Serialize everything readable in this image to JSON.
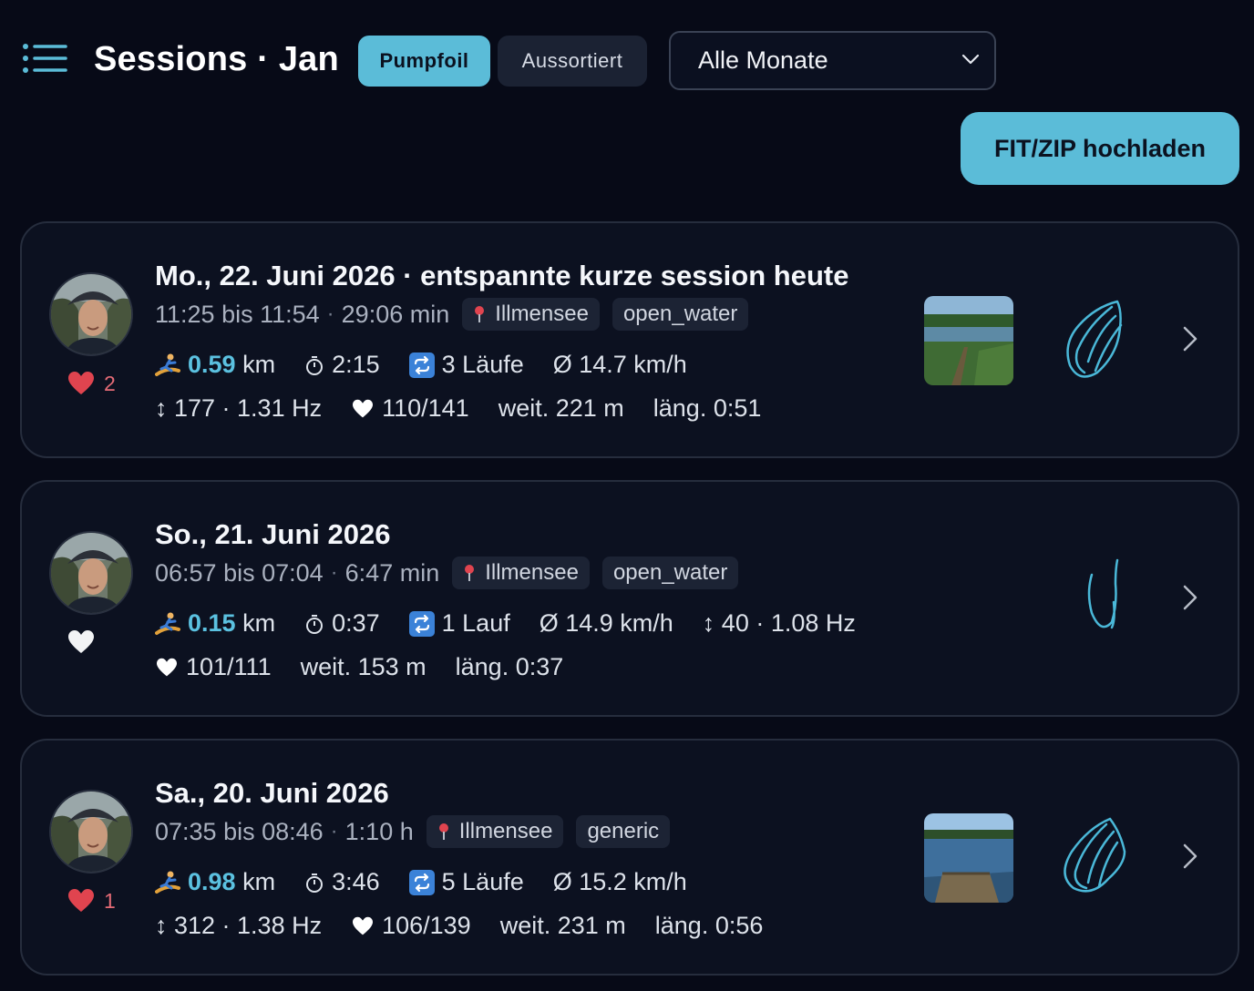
{
  "header": {
    "title": "Sessions · Jan",
    "tabs": [
      {
        "label": "Pumpfoil",
        "active": true
      },
      {
        "label": "Aussortiert",
        "active": false
      }
    ],
    "month_select": {
      "value": "Alle Monate"
    },
    "upload_label": "FIT/ZIP hochladen"
  },
  "colors": {
    "accent": "#5bbcd8",
    "background": "#070a17",
    "card": "#0c1120",
    "like": "#e0444f"
  },
  "sessions": [
    {
      "title": "Mo., 22. Juni 2026 · entspannte kurze session heute",
      "time": "11:25 bis 11:54",
      "duration": "29:06 min",
      "location": "Illmensee",
      "tag": "open_water",
      "liked": true,
      "likes": "2",
      "distance": "0.59",
      "distance_unit": "km",
      "foil_time": "2:15",
      "runs": "3 Läufe",
      "avg_speed": "Ø 14.7 km/h",
      "pumps": "↕ 177 · 1.31 Hz",
      "heart_rate": "110/141",
      "farthest": "weit. 221 m",
      "longest": "läng. 0:51"
    },
    {
      "title": "So., 21. Juni 2026",
      "time": "06:57 bis 07:04",
      "duration": "6:47 min",
      "location": "Illmensee",
      "tag": "open_water",
      "liked": false,
      "likes": "",
      "distance": "0.15",
      "distance_unit": "km",
      "foil_time": "0:37",
      "runs": "1 Lauf",
      "avg_speed": "Ø 14.9 km/h",
      "pumps": "↕ 40 · 1.08 Hz",
      "heart_rate": "101/111",
      "farthest": "weit. 153 m",
      "longest": "läng. 0:37"
    },
    {
      "title": "Sa., 20. Juni 2026",
      "time": "07:35 bis 08:46",
      "duration": "1:10 h",
      "location": "Illmensee",
      "tag": "generic",
      "liked": true,
      "likes": "1",
      "distance": "0.98",
      "distance_unit": "km",
      "foil_time": "3:46",
      "runs": "5 Läufe",
      "avg_speed": "Ø 15.2 km/h",
      "pumps": "↕ 312 · 1.38 Hz",
      "heart_rate": "106/139",
      "farthest": "weit. 231 m",
      "longest": "läng. 0:56"
    }
  ]
}
